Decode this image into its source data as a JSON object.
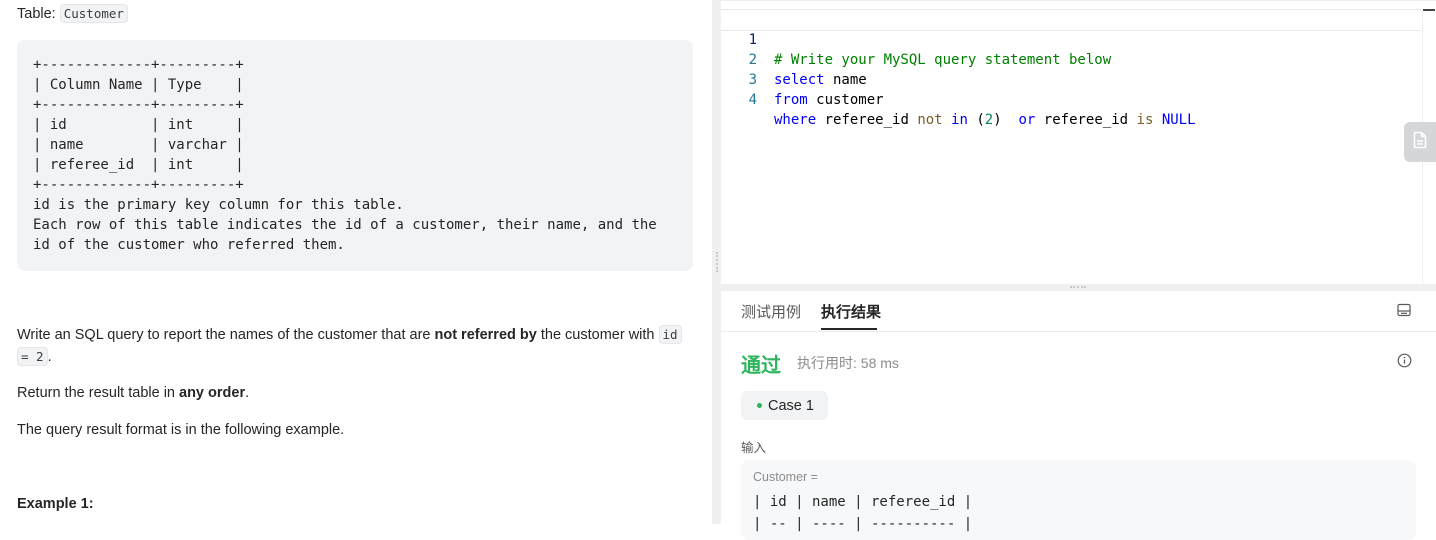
{
  "description": {
    "table_label": "Table:",
    "table_name": "Customer",
    "schema_text": "+-------------+---------+\n| Column Name | Type    |\n+-------------+---------+\n| id          | int     |\n| name        | varchar |\n| referee_id  | int     |\n+-------------+---------+\nid is the primary key column for this table.\nEach row of this table indicates the id of a customer, their name, and the\nid of the customer who referred them.",
    "para1_start": "Write an SQL query to report the names of the customer that are ",
    "para1_bold": "not referred by",
    "para1_mid": " the customer with ",
    "para1_code1": "id",
    "para1_code2": "= 2",
    "para1_end": ".",
    "para2_start": "Return the result table in ",
    "para2_bold": "any order",
    "para2_end": ".",
    "para3": "The query result format is in the following example.",
    "example_heading": "Example 1:"
  },
  "editor": {
    "line_numbers": [
      "1",
      "2",
      "3",
      "4"
    ],
    "line1_comment": "# Write your MySQL query statement below",
    "line2_kw": "select",
    "line2_rest": " name",
    "line3_kw": "from",
    "line3_rest": " customer",
    "line4_kw_where": "where",
    "line4_a": " referee_id ",
    "line4_not": "not",
    "line4_sp1": " ",
    "line4_in": "in",
    "line4_sp2": " (",
    "line4_num": "2",
    "line4_b": ")  ",
    "line4_or": "or",
    "line4_c": " referee_id ",
    "line4_is": "is",
    "line4_sp3": " ",
    "line4_null": "NULL"
  },
  "result_panel": {
    "tabs": [
      "测试用例",
      "执行结果"
    ],
    "active_tab": "执行结果",
    "status": "通过",
    "runtime": "执行用时: 58 ms",
    "case_label": "Case 1",
    "input_label": "输入",
    "input_table_name": "Customer =",
    "input_header_row": "| id | name | referee_id |",
    "input_sep_row": "| -- | ---- | ---------- |"
  },
  "icons": {
    "side_tab": "document-icon",
    "layout": "panel-layout-icon",
    "info": "info-icon"
  },
  "colors": {
    "success": "#2db55d",
    "keyword": "#0000ff",
    "comment": "#008000",
    "number": "#098658"
  }
}
